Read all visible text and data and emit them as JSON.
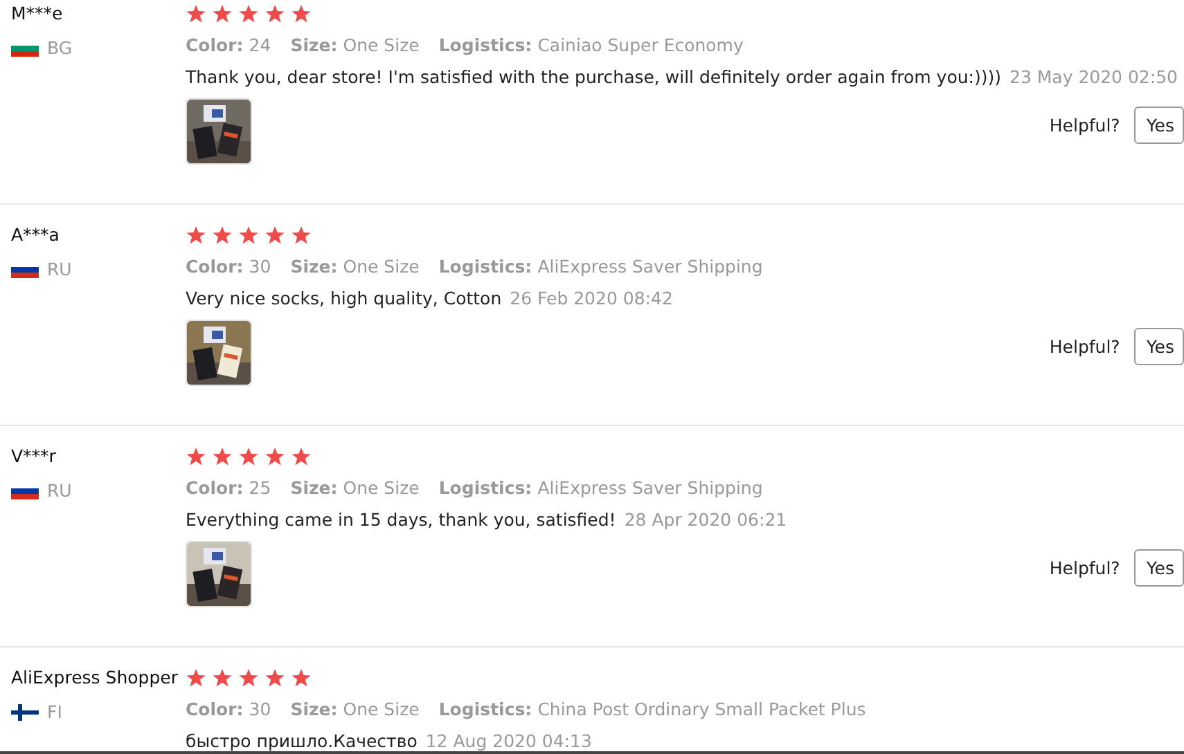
{
  "reviews": [
    {
      "name": "M***e",
      "country": "BG",
      "flag": {
        "kind": "bg"
      },
      "stars": 5,
      "attribute_labels": [
        "Color:",
        "Size:",
        "Logistics:"
      ],
      "attribute_values": [
        "24",
        "One Size",
        "Cainiao Super Economy"
      ],
      "comment": "Thank you, dear store! I'm satisfied with the purchase, will definitely order again from you:))))",
      "date": "23 May 2020 02:50",
      "photo": {
        "kind": "picture"
      },
      "helpful": "Helpful?",
      "yes": "Yes"
    },
    {
      "name": "A***a",
      "country": "RU",
      "flag": {
        "kind": "ru"
      },
      "stars": 5,
      "attribute_labels": [
        "Color:",
        "Size:",
        "Logistics:"
      ],
      "attribute_values": [
        "30",
        "One Size",
        "AliExpress Saver Shipping"
      ],
      "comment": "Very nice socks, high quality, Cotton",
      "date": "26 Feb 2020 08:42",
      "photo": {
        "kind": "picture"
      },
      "helpful": "Helpful?",
      "yes": "Yes"
    },
    {
      "name": "V***r",
      "country": "RU",
      "flag": {
        "kind": "ru"
      },
      "stars": 5,
      "attribute_labels": [
        "Color:",
        "Size:",
        "Logistics:"
      ],
      "attribute_values": [
        "25",
        "One Size",
        "AliExpress Saver Shipping"
      ],
      "comment": "Everything came in 15 days, thank you, satisfied!",
      "date": "28 Apr 2020 06:21",
      "photo": {
        "kind": "picture"
      },
      "helpful": "Helpful?",
      "yes": "Yes"
    },
    {
      "name": "AliExpress Shopper",
      "country": "FI",
      "flag": {
        "kind": "fi"
      },
      "stars": 5,
      "attribute_labels": [
        "Color:",
        "Size:",
        "Logistics:"
      ],
      "attribute_values": [
        "30",
        "One Size",
        "China Post Ordinary Small Packet Plus"
      ],
      "comment": "быстро пришло.Качество",
      "date": "12 Aug 2020 04:13"
    }
  ]
}
